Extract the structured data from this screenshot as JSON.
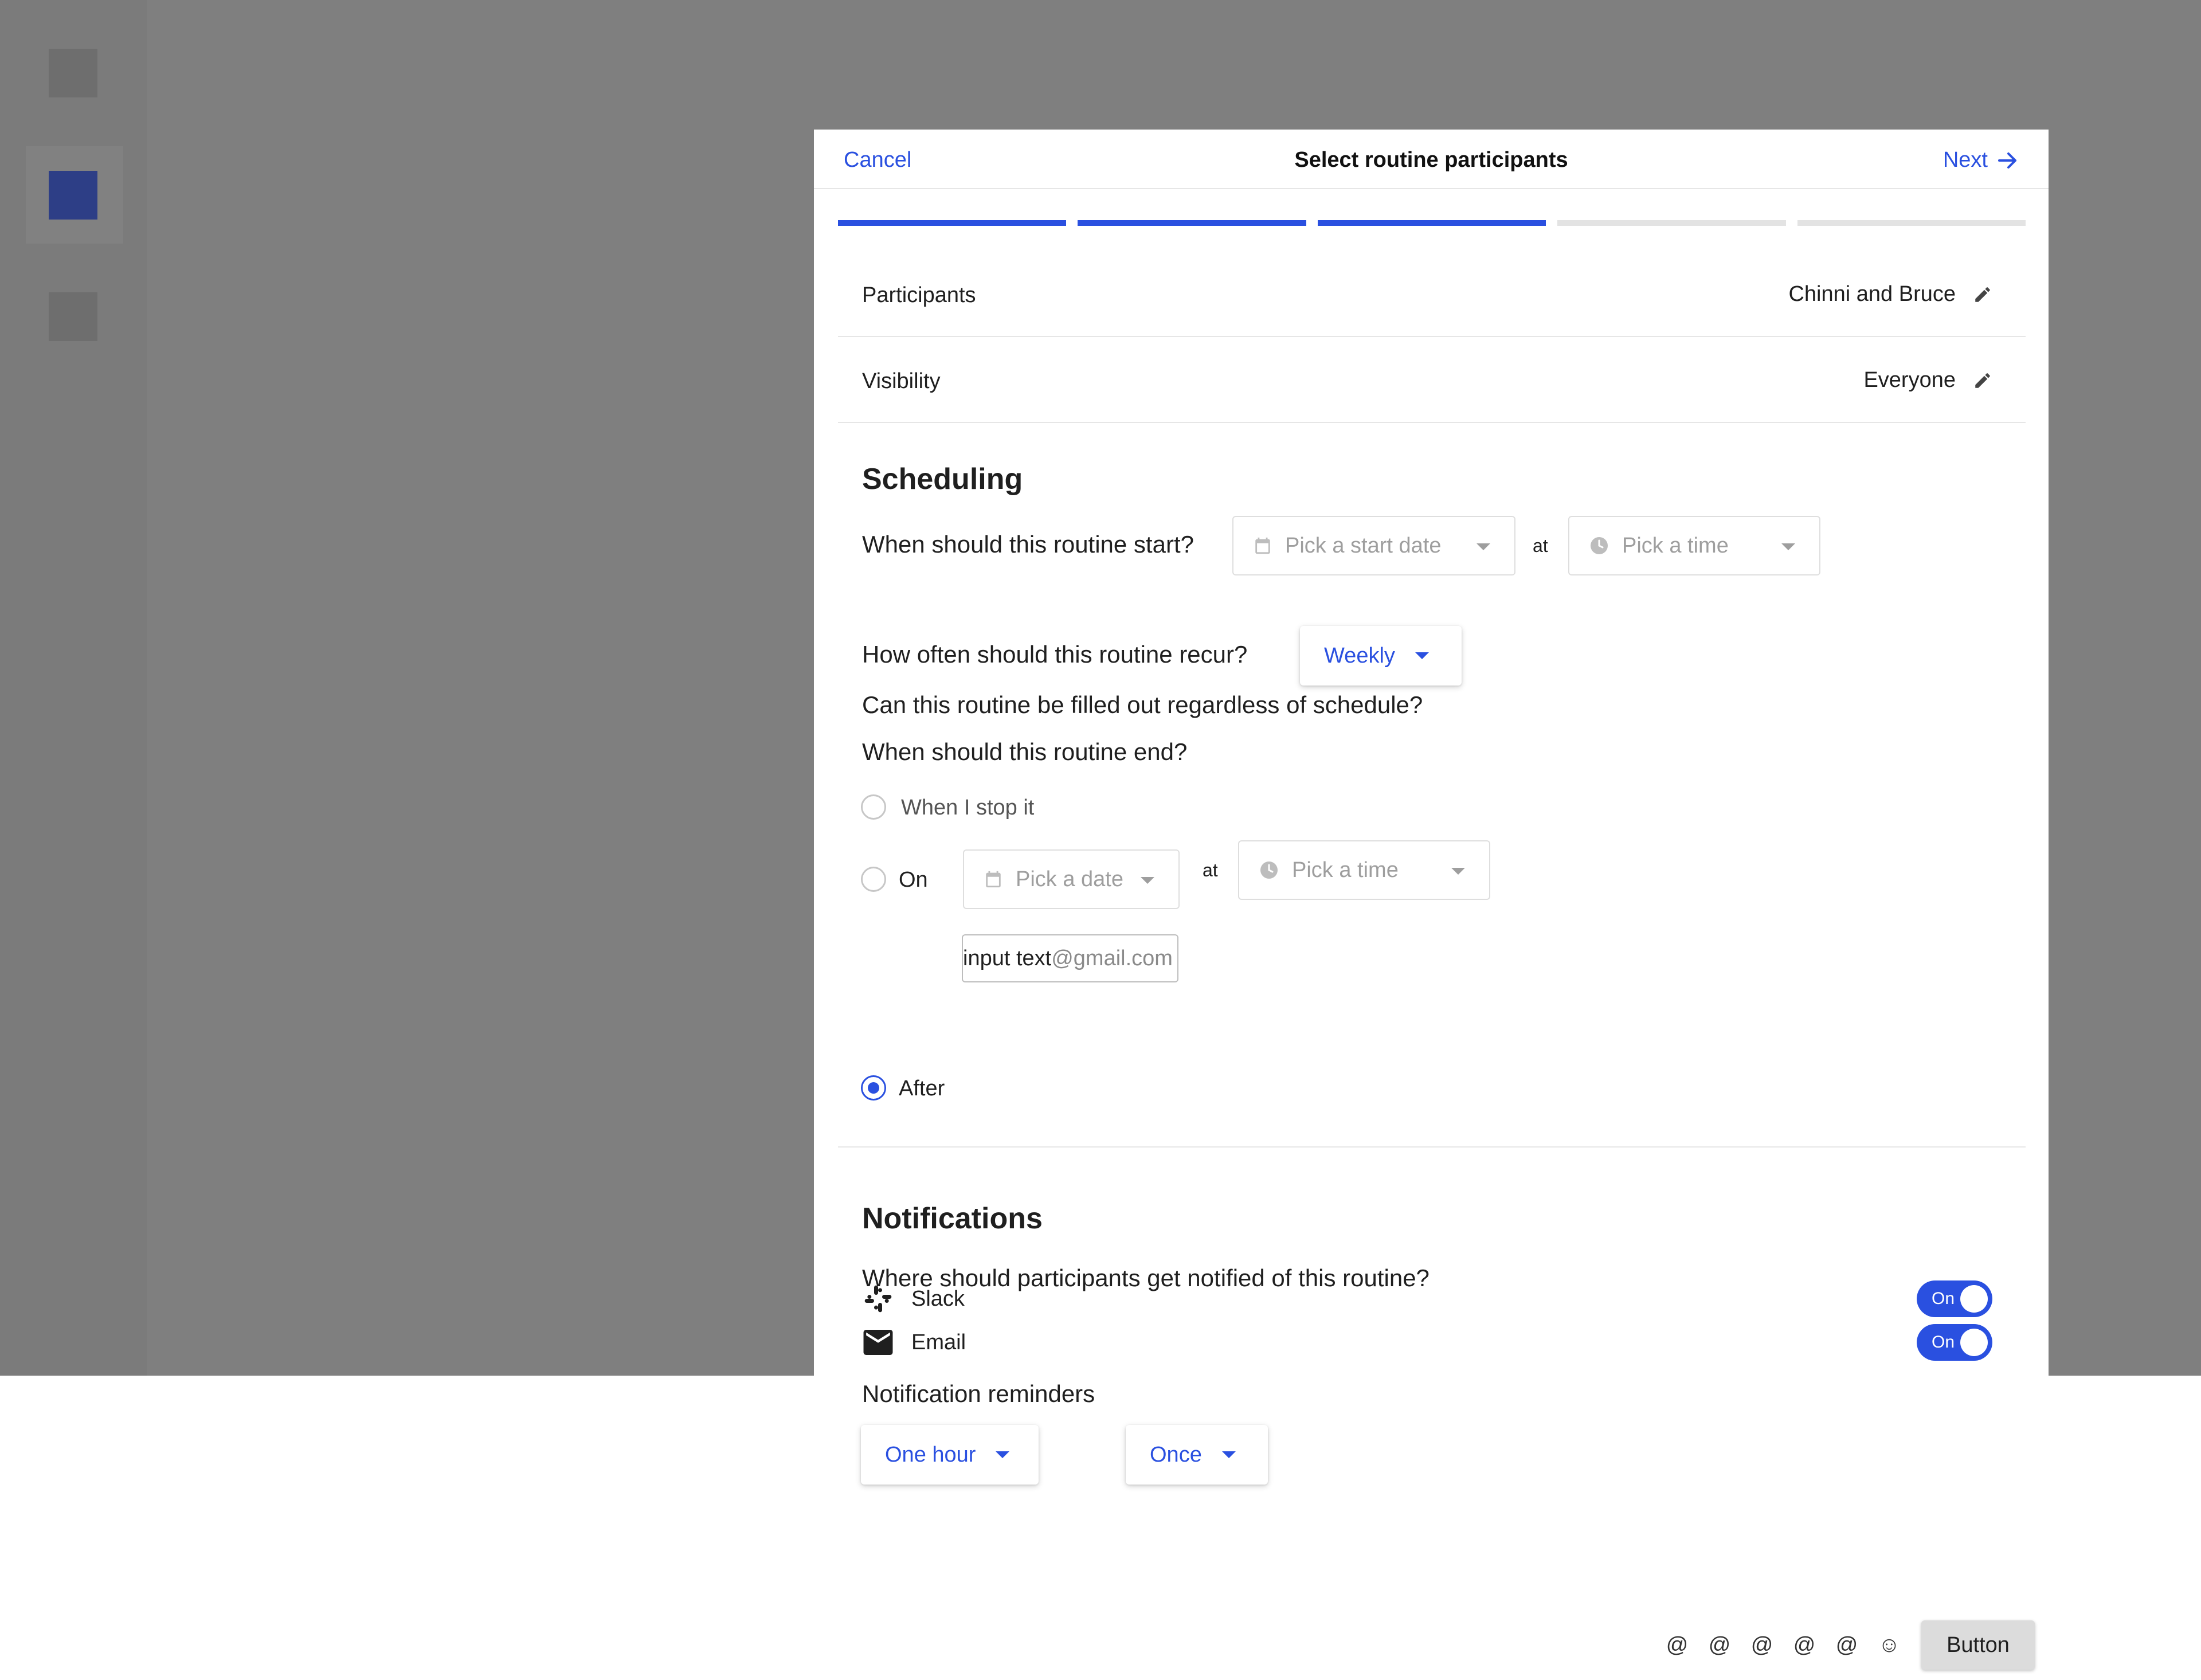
{
  "colors": {
    "accent": "#2a50e0",
    "overlay": "#7f7f7f",
    "sidebar_selected": "#2d3e86"
  },
  "header": {
    "cancel_label": "Cancel",
    "title": "Select routine participants",
    "next_label": "Next"
  },
  "progress": {
    "total_steps": 5,
    "completed_steps": 3
  },
  "summary": {
    "participants": {
      "label": "Participants",
      "value": "Chinni and Bruce"
    },
    "visibility": {
      "label": "Visibility",
      "value": "Everyone"
    }
  },
  "scheduling": {
    "heading": "Scheduling",
    "start_question": "When should this routine start?",
    "start_date_placeholder": "Pick a start date",
    "at_label": "at",
    "start_time_placeholder": "Pick a time",
    "recur_question": "How often should this routine recur?",
    "recur_value": "Weekly",
    "anytime_question": "Can this routine be filled out regardless of schedule?",
    "end_question": "When should this routine end?",
    "end_options": [
      {
        "label": "When I stop it",
        "selected": false
      },
      {
        "label": "On",
        "selected": false
      },
      {
        "label": "After",
        "selected": true
      }
    ],
    "end_date_placeholder": "Pick a date",
    "end_time_placeholder": "Pick a time",
    "after_input_value": "input text",
    "after_input_placeholder": "@gmail.com"
  },
  "notifications": {
    "heading": "Notifications",
    "question": "Where should participants get notified of this routine?",
    "channels": [
      {
        "label": "Email",
        "icon": "mail-icon",
        "toggle": "On"
      },
      {
        "label": "Slack",
        "icon": "slack-icon",
        "toggle": "On"
      }
    ],
    "reminders_label": "Notification reminders",
    "reminder_time": "One hour",
    "reminder_frequency": "Once"
  },
  "footer": {
    "glyphs": [
      "@",
      "@",
      "@",
      "@",
      "@",
      "☺"
    ],
    "button_label": "Button"
  }
}
